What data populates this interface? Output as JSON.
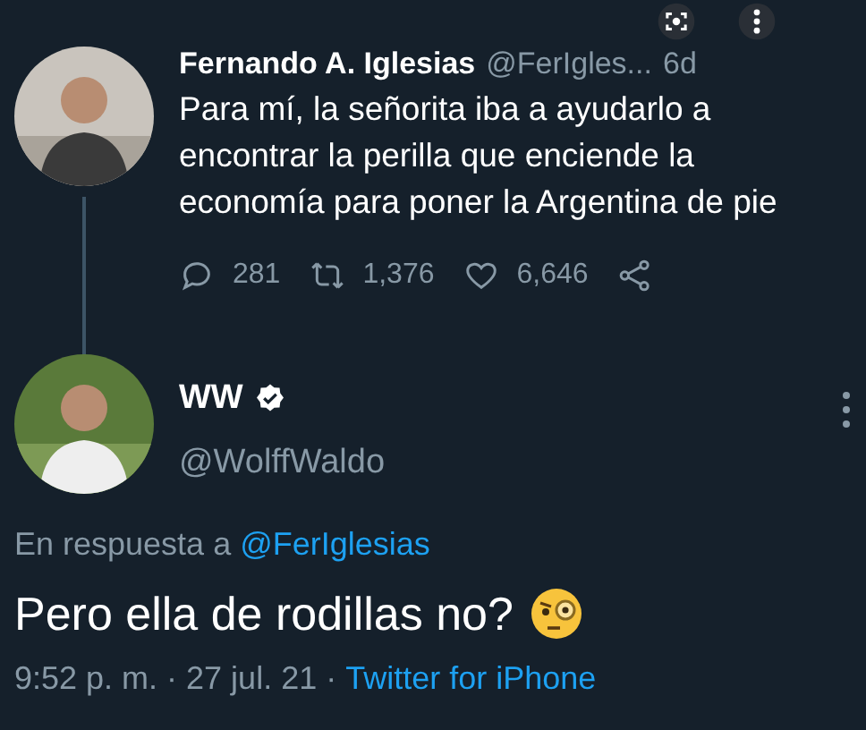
{
  "overlay": {
    "lens": true,
    "more": true
  },
  "tweet": {
    "name": "Fernando A. Iglesias",
    "handle": "@FerIgles...",
    "time": "6d",
    "text": "Para mí, la señorita iba a ayudarlo a encontrar la perilla que enciende la economía para poner la Argentina de pie",
    "replies": "281",
    "retweets": "1,376",
    "likes": "6,646"
  },
  "reply": {
    "name": "WW",
    "verified": true,
    "handle": "@WolffWaldo",
    "in_reply_label": "En respuesta a",
    "in_reply_to": "@FerIglesias",
    "text": "Pero ella de rodillas no?",
    "timestamp": "9:52 p. m. · 27 jul. 21 ·",
    "source": "Twitter for iPhone"
  }
}
